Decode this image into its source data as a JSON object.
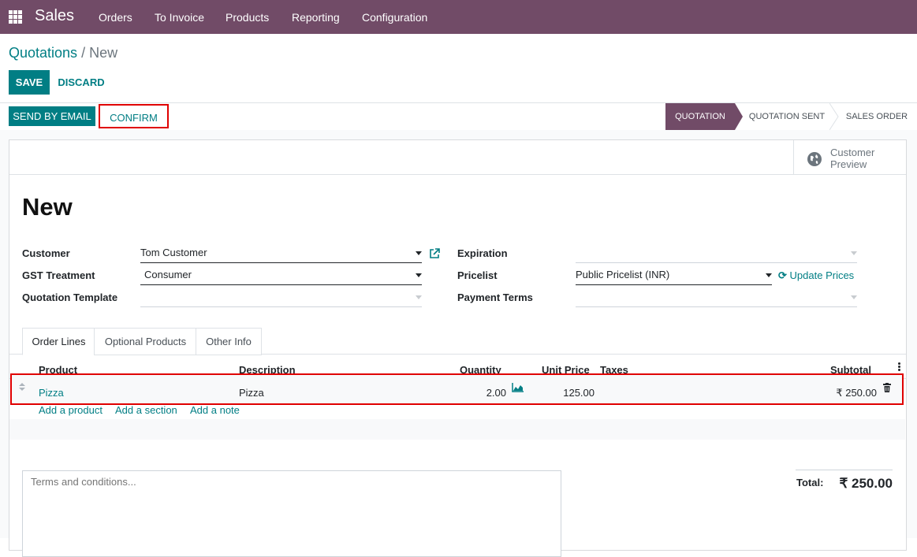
{
  "navbar": {
    "app_name": "Sales",
    "menu": [
      "Orders",
      "To Invoice",
      "Products",
      "Reporting",
      "Configuration"
    ]
  },
  "breadcrumb": {
    "parent": "Quotations",
    "separator": "/",
    "current": "New"
  },
  "actions": {
    "save": "SAVE",
    "discard": "DISCARD"
  },
  "statusbar": {
    "send_by_email": "SEND BY EMAIL",
    "confirm": "CONFIRM",
    "stages": [
      "QUOTATION",
      "QUOTATION SENT",
      "SALES ORDER"
    ],
    "active_stage": "QUOTATION"
  },
  "smart_button": {
    "line1": "Customer",
    "line2": "Preview"
  },
  "record": {
    "title": "New"
  },
  "form": {
    "customer": {
      "label": "Customer",
      "value": "Tom Customer"
    },
    "gst_treatment": {
      "label": "GST Treatment",
      "value": "Consumer"
    },
    "quotation_template": {
      "label": "Quotation Template",
      "value": ""
    },
    "expiration": {
      "label": "Expiration",
      "value": ""
    },
    "pricelist": {
      "label": "Pricelist",
      "value": "Public Pricelist (INR)",
      "update_label": "Update Prices"
    },
    "payment_terms": {
      "label": "Payment Terms",
      "value": ""
    }
  },
  "tabs": [
    "Order Lines",
    "Optional Products",
    "Other Info"
  ],
  "active_tab": "Order Lines",
  "order_lines": {
    "columns": [
      "Product",
      "Description",
      "Quantity",
      "Unit Price",
      "Taxes",
      "Subtotal"
    ],
    "rows": [
      {
        "product": "Pizza",
        "description": "Pizza",
        "quantity": "2.00",
        "unit_price": "125.00",
        "taxes": "",
        "subtotal": "₹ 250.00"
      }
    ],
    "add_links": [
      "Add a product",
      "Add a section",
      "Add a note"
    ]
  },
  "terms": {
    "placeholder": "Terms and conditions..."
  },
  "totals": {
    "label": "Total:",
    "value": "₹ 250.00"
  },
  "colors": {
    "brand": "#714B67",
    "primary": "#017E84",
    "highlight": "#E00000"
  }
}
